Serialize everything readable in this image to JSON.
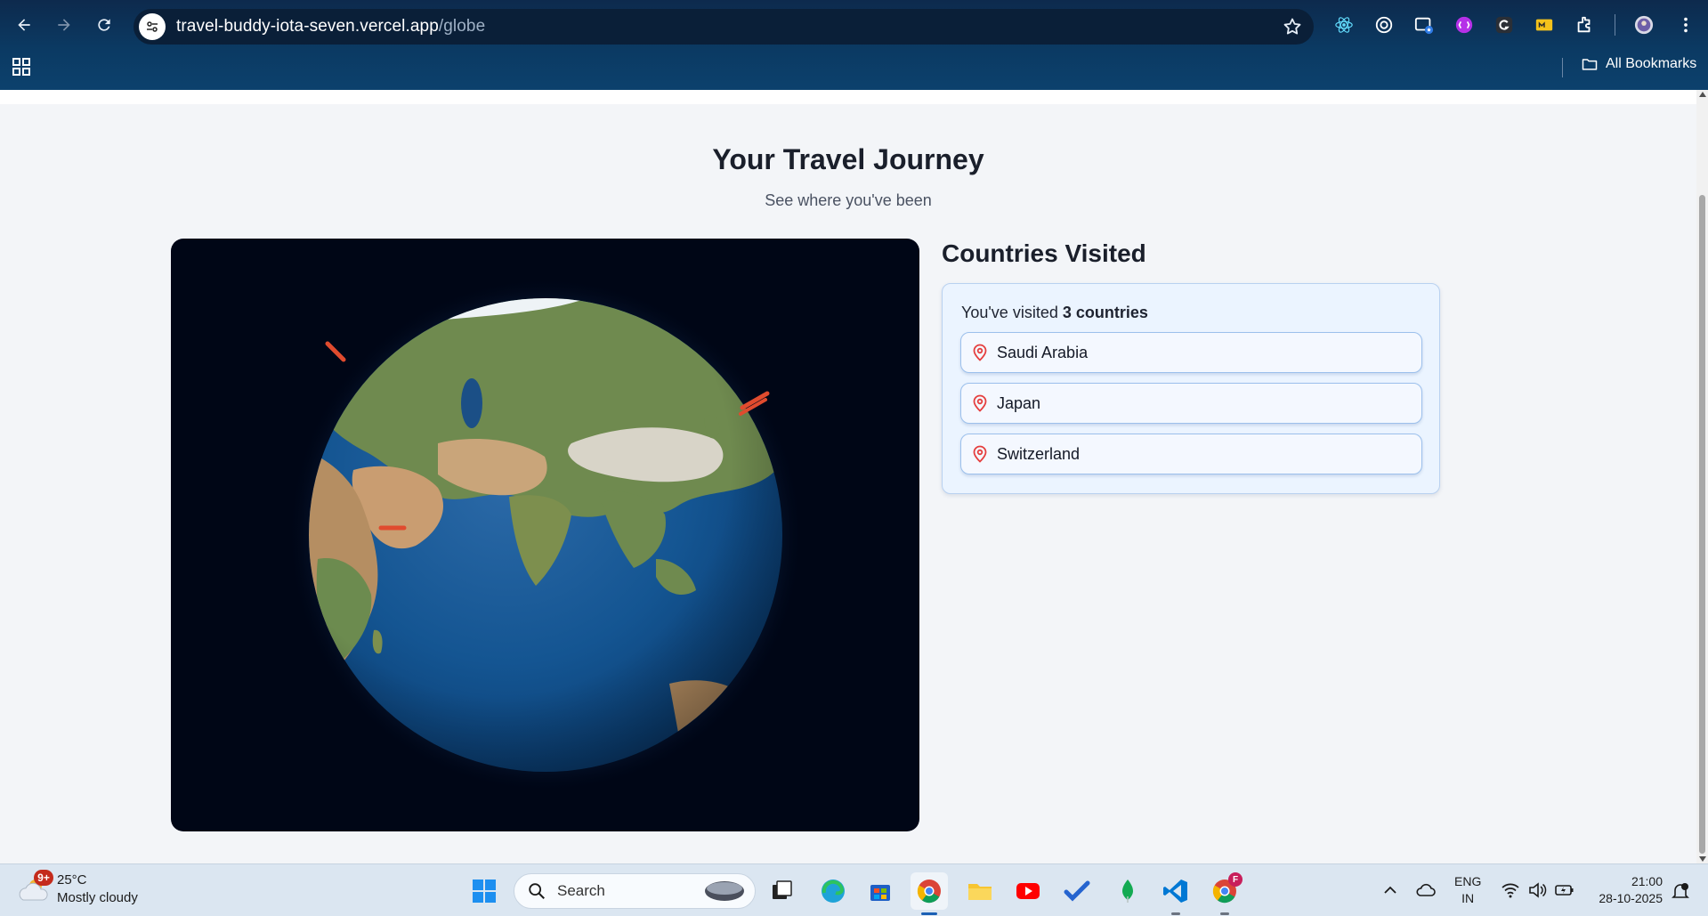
{
  "browser": {
    "url_host": "travel-buddy-iota-seven.vercel.app",
    "url_path": "/globe",
    "bookmarks_label": "All Bookmarks",
    "extensions": [
      "react-devtools-icon",
      "circle-target-icon",
      "window-star-icon",
      "purple-ext-icon",
      "grammarly-icon",
      "yellow-ext-icon",
      "puzzle-icon",
      "profile-avatar-icon",
      "menu-kebab-icon"
    ]
  },
  "page": {
    "title": "Your Travel Journey",
    "subtitle": "See where you've been"
  },
  "countries_panel": {
    "heading": "Countries Visited",
    "summary_prefix": "You've visited ",
    "summary_count": "3 countries",
    "countries": [
      "Saudi Arabia",
      "Japan",
      "Switzerland"
    ],
    "pin_color": "#e53e3e"
  },
  "taskbar": {
    "weather_badge": "9+",
    "weather_temp": "25°C",
    "weather_desc": "Mostly cloudy",
    "search_placeholder": "Search",
    "lang_line1": "ENG",
    "lang_line2": "IN",
    "time": "21:00",
    "date": "28-10-2025",
    "chrome_badge": "F"
  }
}
